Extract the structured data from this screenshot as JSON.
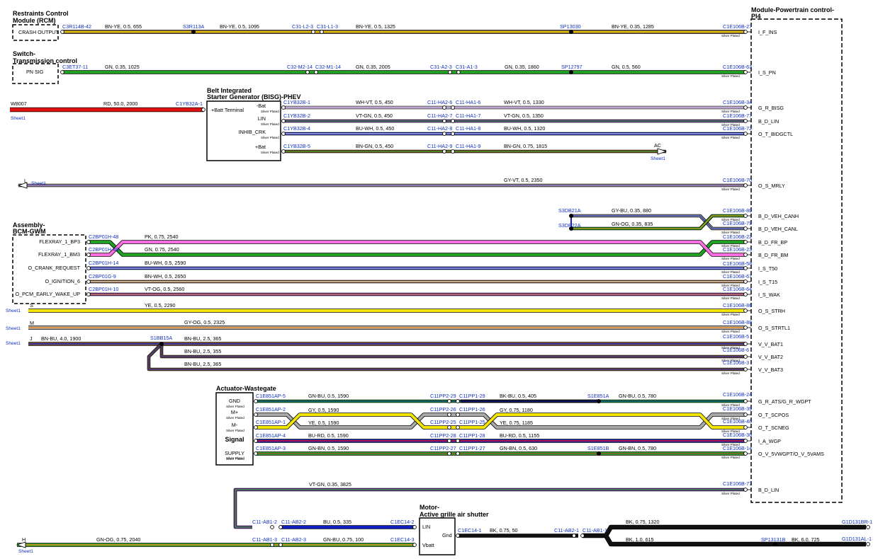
{
  "modules": {
    "rcm": {
      "title1": "Restraints Control",
      "title2": "Module (RCM)",
      "pin": "CRASH OUTPUT"
    },
    "tcm": {
      "title1": "Switch-",
      "title2": "Transmission control",
      "pin": "PN SIG"
    },
    "pcm": {
      "title1": "Module-Powertrain control-",
      "title2": "PI4"
    },
    "bisg": {
      "title1": "Belt Integrated",
      "title2": "Starter Generator (BISG)-PHEV",
      "batt_terminal": "+Batt Terminal",
      "pins": [
        "-Bat",
        "LIN",
        "INHIB_CRK",
        "+Bat"
      ]
    },
    "bcm": {
      "title1": "Assembly-",
      "title2": "BCM-GWM",
      "pins": [
        "FLEXRAY_1_BP3",
        "FLEXRAY_1_BM3",
        "O_CRANK_REQUEST",
        "O_IGNITION_6",
        "O_PCM_EARLY_WAKE_UP"
      ]
    },
    "wastegate": {
      "title": "Actuator-Wastegate",
      "pins": [
        "GND",
        "M+",
        "M-",
        "Signal",
        "SUPPLY"
      ]
    },
    "shutter": {
      "title1": "Motor-",
      "title2": "Active grille air shutter",
      "pins": [
        "LIN",
        "Gnd",
        "Vbatt"
      ]
    }
  },
  "silver": "Silver Plated",
  "sheet": "Sheet1",
  "offpage": {
    "w8007": "W8007",
    "ac": "AC",
    "l": "L",
    "s": "S",
    "m": "M",
    "j": "J",
    "h": "H"
  },
  "pcm_pins": [
    {
      "conn": "C1E106B-27",
      "sig": "I_F_INS"
    },
    {
      "conn": "C1E106B-63",
      "sig": "I_S_PN"
    },
    {
      "conn": "C1E106B-34",
      "sig": "G_R_BISG"
    },
    {
      "conn": "C1E106B-77",
      "sig": "B_D_LIN"
    },
    {
      "conn": "C1E106B-72",
      "sig": "O_T_BIDGCTL"
    },
    {
      "conn": "C1E106B-70",
      "sig": "O_S_MRLY"
    },
    {
      "conn": "C1E106B-80",
      "sig": "B_D_VEH_CANH"
    },
    {
      "conn": "C1E106B-79",
      "sig": "B_D_VEH_CANL"
    },
    {
      "conn": "C1E106B-22",
      "sig": "B_D_FR_BP"
    },
    {
      "conn": "C1E106B-23",
      "sig": "B_D_FR_BM"
    },
    {
      "conn": "C1E106B-58",
      "sig": "I_S_T50"
    },
    {
      "conn": "C1E106B-67",
      "sig": "I_S_T15"
    },
    {
      "conn": "C1E106B-64",
      "sig": "I_S_WAK"
    },
    {
      "conn": "C1E106B-86",
      "sig": "O_S_STRH"
    },
    {
      "conn": "C1E106B-88",
      "sig": "O_S_STRTL1"
    },
    {
      "conn": "C1E106B-5",
      "sig": "V_V_BAT1"
    },
    {
      "conn": "C1E106B-6",
      "sig": "V_V_BAT2"
    },
    {
      "conn": "C1E106B-3",
      "sig": "V_V_BAT3"
    },
    {
      "conn": "C1E106B-24",
      "sig": "G_R_ATS/G_R_WGPT"
    },
    {
      "conn": "C1E106B-39",
      "sig": "O_T_SCPOS"
    },
    {
      "conn": "C1E106B-40",
      "sig": "O_T_SCNEG"
    },
    {
      "conn": "C1E106B-36",
      "sig": "I_A_WGP"
    },
    {
      "conn": "C1E106B-14",
      "sig": "O_V_5VWGPT/O_V_5VAMS"
    },
    {
      "conn": "C1E106B-77",
      "sig": "B_D_LIN"
    }
  ],
  "connectors": {
    "rcm": "C3R114B-42",
    "tcm": "C3ET37-11",
    "bisg_batt": "C1YB32A-1",
    "bisg": [
      "C1YB32B-1",
      "C1YB32B-2",
      "C1YB32B-4",
      "C1YB32B-5"
    ],
    "bcm": [
      "C2BP01H-48",
      "C2BP01H-49",
      "C2BP01H-14",
      "C2BP01G-9",
      "C2BP01H-10"
    ],
    "wg": [
      "C1E851AP-5",
      "C1E851AP-2",
      "C1E851AP-1",
      "C1E851AP-4",
      "C1E851AP-3"
    ],
    "sh": [
      "C1EC14-2",
      "C1EC14-3",
      "C1EC14-1"
    ],
    "c31": [
      "C31-L2-3",
      "C31-L1-3"
    ],
    "c32": [
      "C32-M2-14",
      "C32-M1-14"
    ],
    "c31a": [
      "C31-A2-3",
      "C31-A1-3"
    ],
    "c11ha": [
      [
        "C11-HA2-6",
        "C11-HA1-6"
      ],
      [
        "C11-HA2-7",
        "C11-HA1-7"
      ],
      [
        "C11-HA2-8",
        "C11-HA1-8"
      ],
      [
        "C11-HA2-9",
        "C11-HA1-9"
      ]
    ],
    "c11pp": [
      [
        "C11PP2-29",
        "C11PP1-29"
      ],
      [
        "C11PP2-26",
        "C11PP1-26"
      ],
      [
        "C11PP2-25",
        "C11PP1-25"
      ],
      [
        "C11PP2-28",
        "C11PP1-28"
      ],
      [
        "C11PP2-27",
        "C11PP1-27"
      ]
    ],
    "c11ab": [
      [
        "C11-AB1-2",
        "C11-AB2-2"
      ],
      [
        "C11-AB1-3",
        "C11-AB2-3"
      ],
      [
        "C11-AB2-1",
        "C11-AB1-1"
      ]
    ],
    "ground": [
      "G1D131BR-1",
      "G1D131AL-1"
    ]
  },
  "splices": [
    "S3R113A",
    "SP13030",
    "SP12797",
    "S3DB21A",
    "S3DB22A",
    "S1BB15A",
    "S1E851A",
    "S1E851B",
    "SP13131B"
  ],
  "wires": {
    "rcm": [
      "BN-YE, 0.5, 655",
      "BN-YE, 0.5, 1095",
      "BN-YE, 0.5, 1325",
      "BN-YE, 0.35, 1285"
    ],
    "tcm": [
      "GN, 0.35, 1025",
      "GN, 0.35, 2005",
      "GN, 0.35, 1860",
      "GN, 0.5, 560"
    ],
    "bisg_batt": "RD, 50.0, 2000",
    "bisg": [
      [
        "WH-VT, 0.5, 450",
        "WH-VT, 0.5, 1330"
      ],
      [
        "VT-GN, 0.5, 450",
        "VT-GN, 0.5, 1350"
      ],
      [
        "BU-WH, 0.5, 450",
        "BU-WH, 0.5, 1320"
      ],
      [
        "BN-GN, 0.5, 450",
        "BN-GN, 0.75, 1815"
      ]
    ],
    "mrly": "GY-VT, 0.5, 2350",
    "can": [
      "GY-BU, 0.35, 880",
      "GN-OG, 0.35, 835"
    ],
    "bcm": [
      "GN, 0.75, 2540",
      "PK, 0.75, 2540",
      "BU-WH, 0.5, 2590",
      "BN-WH, 0.5, 2650",
      "VT-OG, 0.5, 2560"
    ],
    "strh": "YE, 0.5, 2290",
    "strtl": "GY-OG, 0.5, 2325",
    "bat": [
      "BN-BU, 4.0, 1900",
      "BN-BU, 2.5, 365",
      "BN-BU, 2.5, 355",
      "BN-BU, 2.5, 365"
    ],
    "wg": [
      [
        "GN-BU, 0.5, 1590",
        "BK-BU, 0.5, 405",
        "GN-BU, 0.5, 780"
      ],
      [
        "GY, 0.5, 1590",
        "GY, 0.75, 1180"
      ],
      [
        "YE, 0.5, 1590",
        "YE, 0.75, 1185"
      ],
      [
        "BU-RD, 0.5, 1590",
        "BU-RD, 0.5, 1155"
      ],
      [
        "GN-BN, 0.5, 1590",
        "GN-BN, 0.5, 630",
        "GN-BN, 0.5, 780"
      ]
    ],
    "lin": "VT-GN, 0.35, 3825",
    "sh": [
      "BU, 0.5, 335",
      "GN-BU, 0.75, 100",
      "GN-OG, 0.75, 2040",
      "BK, 0.75, 50",
      "BK, 0.75, 1320",
      "BK, 1.0, 615",
      "BK, 6.0, 725"
    ]
  },
  "colors": {
    "BN": "#8b5a2b",
    "YE": "#f2e600",
    "GN": "#1fa020",
    "RD": "#e01010",
    "WH": "#ffffff",
    "VT": "#8040b0",
    "BU": "#1020c0",
    "GY": "#a8a8a8",
    "PK": "#ff6ee0",
    "OG": "#f08a20",
    "BK": "#101010"
  }
}
